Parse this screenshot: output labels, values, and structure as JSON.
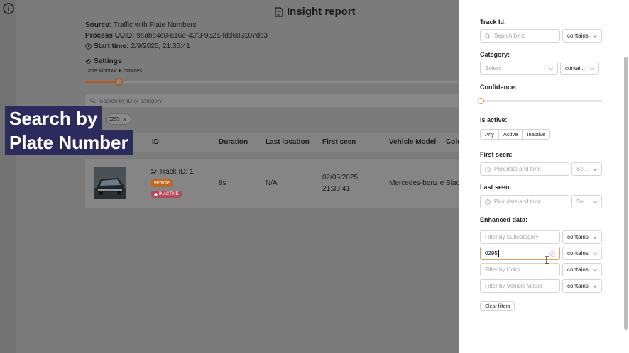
{
  "report": {
    "title": "Insight report",
    "source_label": "Source:",
    "source_value": "Traffic with Plate Numbers",
    "uuid_label": "Process UUID:",
    "uuid_value": "9eabe4c8-a16e-43f3-952a-fdd689107dc3",
    "start_label": "Start time:",
    "start_value": "2/9/2025, 21:30:41",
    "settings_label": "Settings",
    "window_label": "Time window:",
    "window_value": "6",
    "window_unit": "minutes",
    "time_window_fraction": 0.09,
    "search_placeholder": "Search by ID or category",
    "chip_value": "0295",
    "chip_close": "×"
  },
  "table": {
    "columns": [
      "ID",
      "Duration",
      "Last location",
      "First seen",
      "Vehicle Model",
      "Colo"
    ],
    "rows": [
      {
        "track_label": "Track ID:",
        "track_id": "1",
        "category_badge": "vehicle",
        "status_badge": "INACTIVE",
        "duration": "8s",
        "last_location": "N/A",
        "first_seen_date": "02/09/2025",
        "first_seen_time": "21:30:41",
        "vehicle_model": "Mercedes-benz e",
        "color": "Blac"
      }
    ]
  },
  "caption": {
    "line1": "Search by",
    "line2": "Plate Number"
  },
  "filters": {
    "track_id_label": "Track Id:",
    "track_id_placeholder": "Search by id",
    "track_id_op": "contains",
    "category_label": "Category:",
    "category_placeholder": "Select",
    "category_op": "contai...",
    "confidence_label": "Confidence:",
    "confidence_value": 0,
    "active_label": "Is active:",
    "active_options": [
      "Any",
      "Active",
      "Inactive"
    ],
    "first_seen_label": "First seen:",
    "first_seen_placeholder": "Pick date and time",
    "first_seen_op": "Se...",
    "last_seen_label": "Last seen:",
    "last_seen_placeholder": "Pick date and time",
    "last_seen_op": "Se...",
    "enhanced_label": "Enhanced data:",
    "subcategory_placeholder": "Filter by Subcategory",
    "subcategory_op": "contains",
    "plate_value": "0295",
    "plate_op": "contains",
    "color_placeholder": "Filter by Color",
    "color_op": "contains",
    "model_placeholder": "Filter by Vehicle Model",
    "model_op": "contains",
    "clear_label": "Clear filters"
  },
  "colors": {
    "accent": "#b35a1f",
    "vehicle_badge": "#c0671e",
    "inactive_badge": "#b8485a",
    "caption_bg": "#2d2a5e"
  }
}
